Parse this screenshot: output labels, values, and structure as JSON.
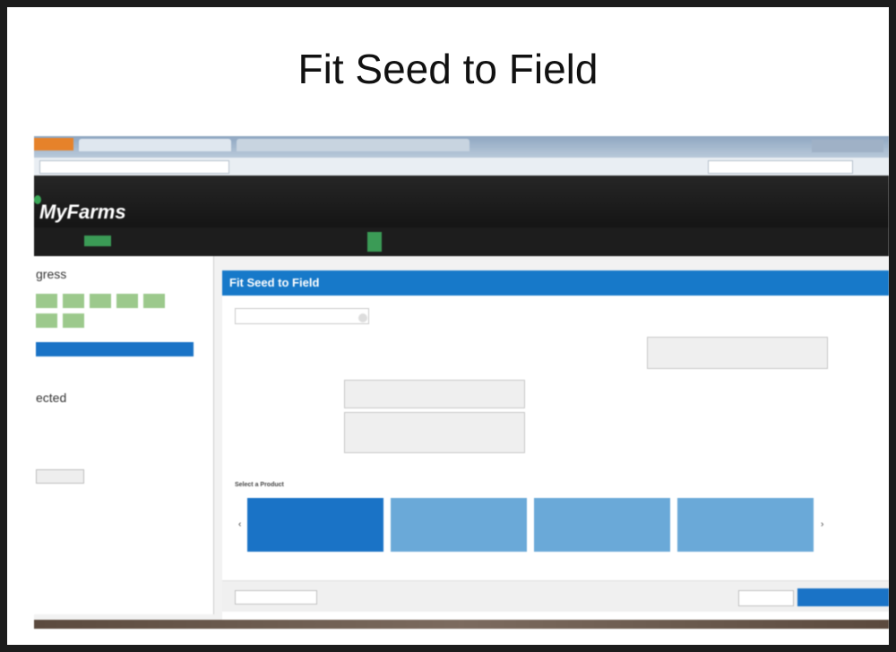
{
  "slide": {
    "title": "Fit Seed to Field"
  },
  "app": {
    "logo": "MyFarms",
    "season_badge": "",
    "nav": [
      {
        "label": ""
      },
      {
        "label": ""
      },
      {
        "label": ""
      },
      {
        "label": ""
      },
      {
        "label": ""
      },
      {
        "label": ""
      },
      {
        "label": ""
      }
    ],
    "active_nav_index": 3
  },
  "sidebar": {
    "progress_heading": "gress",
    "progress_step_count": 7,
    "selected_heading": "ected"
  },
  "main": {
    "title": "Fit Seed to Field",
    "scenario_select": "",
    "count": "",
    "select_product_label": "Select a Product",
    "cards": [
      {
        "selected": true
      },
      {
        "selected": false
      },
      {
        "selected": false
      },
      {
        "selected": false
      }
    ]
  },
  "colors": {
    "brand_blue": "#1779c9",
    "brand_green": "#3b9b56",
    "header_dark": "#1d1d1d"
  }
}
